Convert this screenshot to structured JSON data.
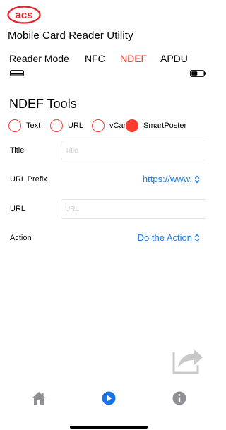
{
  "header": {
    "logo_text": "acs",
    "app_title": "Mobile Card Reader Utility"
  },
  "tabs": [
    {
      "label": "Reader Mode",
      "active": false
    },
    {
      "label": "NFC",
      "active": false
    },
    {
      "label": "NDEF",
      "active": true
    },
    {
      "label": "APDU",
      "active": false
    }
  ],
  "status": {
    "reader_icon": "card-reader-icon",
    "battery_icon": "battery-icon"
  },
  "section": {
    "title": "NDEF Tools"
  },
  "record_types": [
    {
      "label": "Text",
      "selected": false
    },
    {
      "label": "URL",
      "selected": false
    },
    {
      "label": "vCard",
      "selected": false
    },
    {
      "label": "SmartPoster",
      "selected": true
    }
  ],
  "form": {
    "title_label": "Title",
    "title_value": "",
    "title_placeholder": "Title",
    "url_prefix_label": "URL Prefix",
    "url_prefix_value": "https://www.",
    "url_label": "URL",
    "url_value": "",
    "url_placeholder": "URL",
    "action_label": "Action",
    "action_value": "Do the Action"
  },
  "bottom_bar": {
    "items": [
      "home-icon",
      "play-icon",
      "info-icon"
    ],
    "selected": "play-icon"
  },
  "colors": {
    "accent_red": "#ff3b30",
    "link_blue": "#1f7ae0",
    "tab_selected_blue": "#1a73e8",
    "icon_gray": "#8e8e93"
  }
}
